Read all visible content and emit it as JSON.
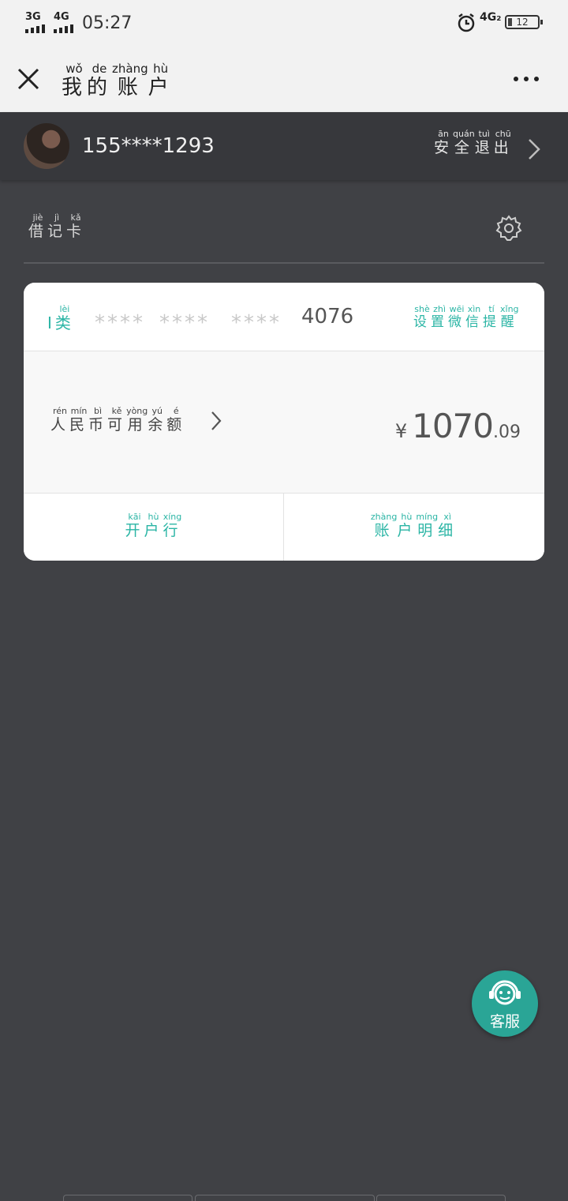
{
  "status_bar": {
    "sim1": "3G",
    "sim2": "4G",
    "time": "05:27",
    "network": "4G₂",
    "battery": "12"
  },
  "header": {
    "title": [
      {
        "char": "我",
        "pinyin": "wǒ"
      },
      {
        "char": "的",
        "pinyin": "de"
      },
      {
        "char": "账",
        "pinyin": "zhàng"
      },
      {
        "char": "户",
        "pinyin": "hù"
      }
    ],
    "more_icon": "…"
  },
  "account": {
    "phone": "155****1293",
    "logout": [
      {
        "char": "安",
        "pinyin": "ān"
      },
      {
        "char": "全",
        "pinyin": "quán"
      },
      {
        "char": "退",
        "pinyin": "tuì"
      },
      {
        "char": "出",
        "pinyin": "chū"
      }
    ]
  },
  "card_section": {
    "type": [
      {
        "char": "借",
        "pinyin": "jiè"
      },
      {
        "char": "记",
        "pinyin": "jì"
      },
      {
        "char": "卡",
        "pinyin": "kǎ"
      }
    ]
  },
  "card": {
    "class_prefix": "I",
    "class_char": {
      "char": "类",
      "pinyin": "lèi"
    },
    "masked_groups": [
      "****",
      "****",
      "****"
    ],
    "last4": "4076",
    "wechat_remind": [
      {
        "char": "设",
        "pinyin": "shè"
      },
      {
        "char": "置",
        "pinyin": "zhì"
      },
      {
        "char": "微",
        "pinyin": "wēi"
      },
      {
        "char": "信",
        "pinyin": "xìn"
      },
      {
        "char": "提",
        "pinyin": "tí"
      },
      {
        "char": "醒",
        "pinyin": "xǐng"
      }
    ],
    "balance_label": [
      {
        "char": "人",
        "pinyin": "rén"
      },
      {
        "char": "民",
        "pinyin": "mín"
      },
      {
        "char": "币",
        "pinyin": "bì"
      },
      {
        "char": "可",
        "pinyin": "kě"
      },
      {
        "char": "用",
        "pinyin": "yòng"
      },
      {
        "char": "余",
        "pinyin": "yú"
      },
      {
        "char": "额",
        "pinyin": "é"
      }
    ],
    "currency": "¥",
    "balance_int": "1070",
    "balance_dec": ".09",
    "opening_bank": [
      {
        "char": "开",
        "pinyin": "kāi"
      },
      {
        "char": "户",
        "pinyin": "hù"
      },
      {
        "char": "行",
        "pinyin": "xíng"
      }
    ],
    "account_detail": [
      {
        "char": "账",
        "pinyin": "zhàng"
      },
      {
        "char": "户",
        "pinyin": "hù"
      },
      {
        "char": "明",
        "pinyin": "míng"
      },
      {
        "char": "细",
        "pinyin": "xì"
      }
    ]
  },
  "service": {
    "label": "客服"
  },
  "colors": {
    "accent": "#2bb5a5",
    "background": "#404145",
    "header_bg": "#f2f2f2"
  }
}
